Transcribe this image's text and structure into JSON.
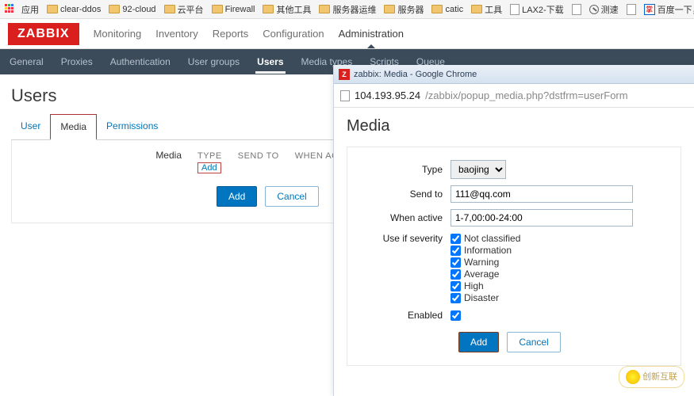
{
  "bookmarks": {
    "apps": "应用",
    "items": [
      {
        "label": "clear-ddos"
      },
      {
        "label": "92-cloud"
      },
      {
        "label": "云平台"
      },
      {
        "label": "Firewall"
      },
      {
        "label": "其他工具"
      },
      {
        "label": "服务器运维"
      },
      {
        "label": "服务器"
      },
      {
        "label": "catic"
      },
      {
        "label": "工具"
      },
      {
        "label": "LAX2-下载",
        "doc": true
      },
      {
        "label": "",
        "doc": true
      },
      {
        "label": "测速",
        "circle": true
      },
      {
        "label": "",
        "doc": true
      },
      {
        "label": "百度一下，你就知道",
        "paw": true
      }
    ]
  },
  "logo": "ZABBIX",
  "topnav": {
    "items": [
      "Monitoring",
      "Inventory",
      "Reports",
      "Configuration",
      "Administration"
    ],
    "active": 4
  },
  "subnav": {
    "items": [
      "General",
      "Proxies",
      "Authentication",
      "User groups",
      "Users",
      "Media types",
      "Scripts",
      "Queue"
    ],
    "active": 4
  },
  "page_title": "Users",
  "tabs": {
    "items": [
      "User",
      "Media",
      "Permissions"
    ],
    "active": 1
  },
  "media_section": {
    "label": "Media",
    "cols": [
      "TYPE",
      "SEND TO",
      "WHEN ACT"
    ],
    "add_link": "Add"
  },
  "main_buttons": {
    "add": "Add",
    "cancel": "Cancel"
  },
  "popup": {
    "title": "zabbix: Media - Google Chrome",
    "url_host": "104.193.95.24",
    "url_path": "/zabbix/popup_media.php?dstfrm=userForm",
    "heading": "Media",
    "form": {
      "type": {
        "label": "Type",
        "value": "baojing"
      },
      "sendto": {
        "label": "Send to",
        "value": "111@qq.com"
      },
      "whenactive": {
        "label": "When active",
        "value": "1-7,00:00-24:00"
      },
      "severity": {
        "label": "Use if severity",
        "options": [
          "Not classified",
          "Information",
          "Warning",
          "Average",
          "High",
          "Disaster"
        ]
      },
      "enabled": {
        "label": "Enabled"
      }
    },
    "buttons": {
      "add": "Add",
      "cancel": "Cancel"
    }
  },
  "watermark": "创新互联"
}
